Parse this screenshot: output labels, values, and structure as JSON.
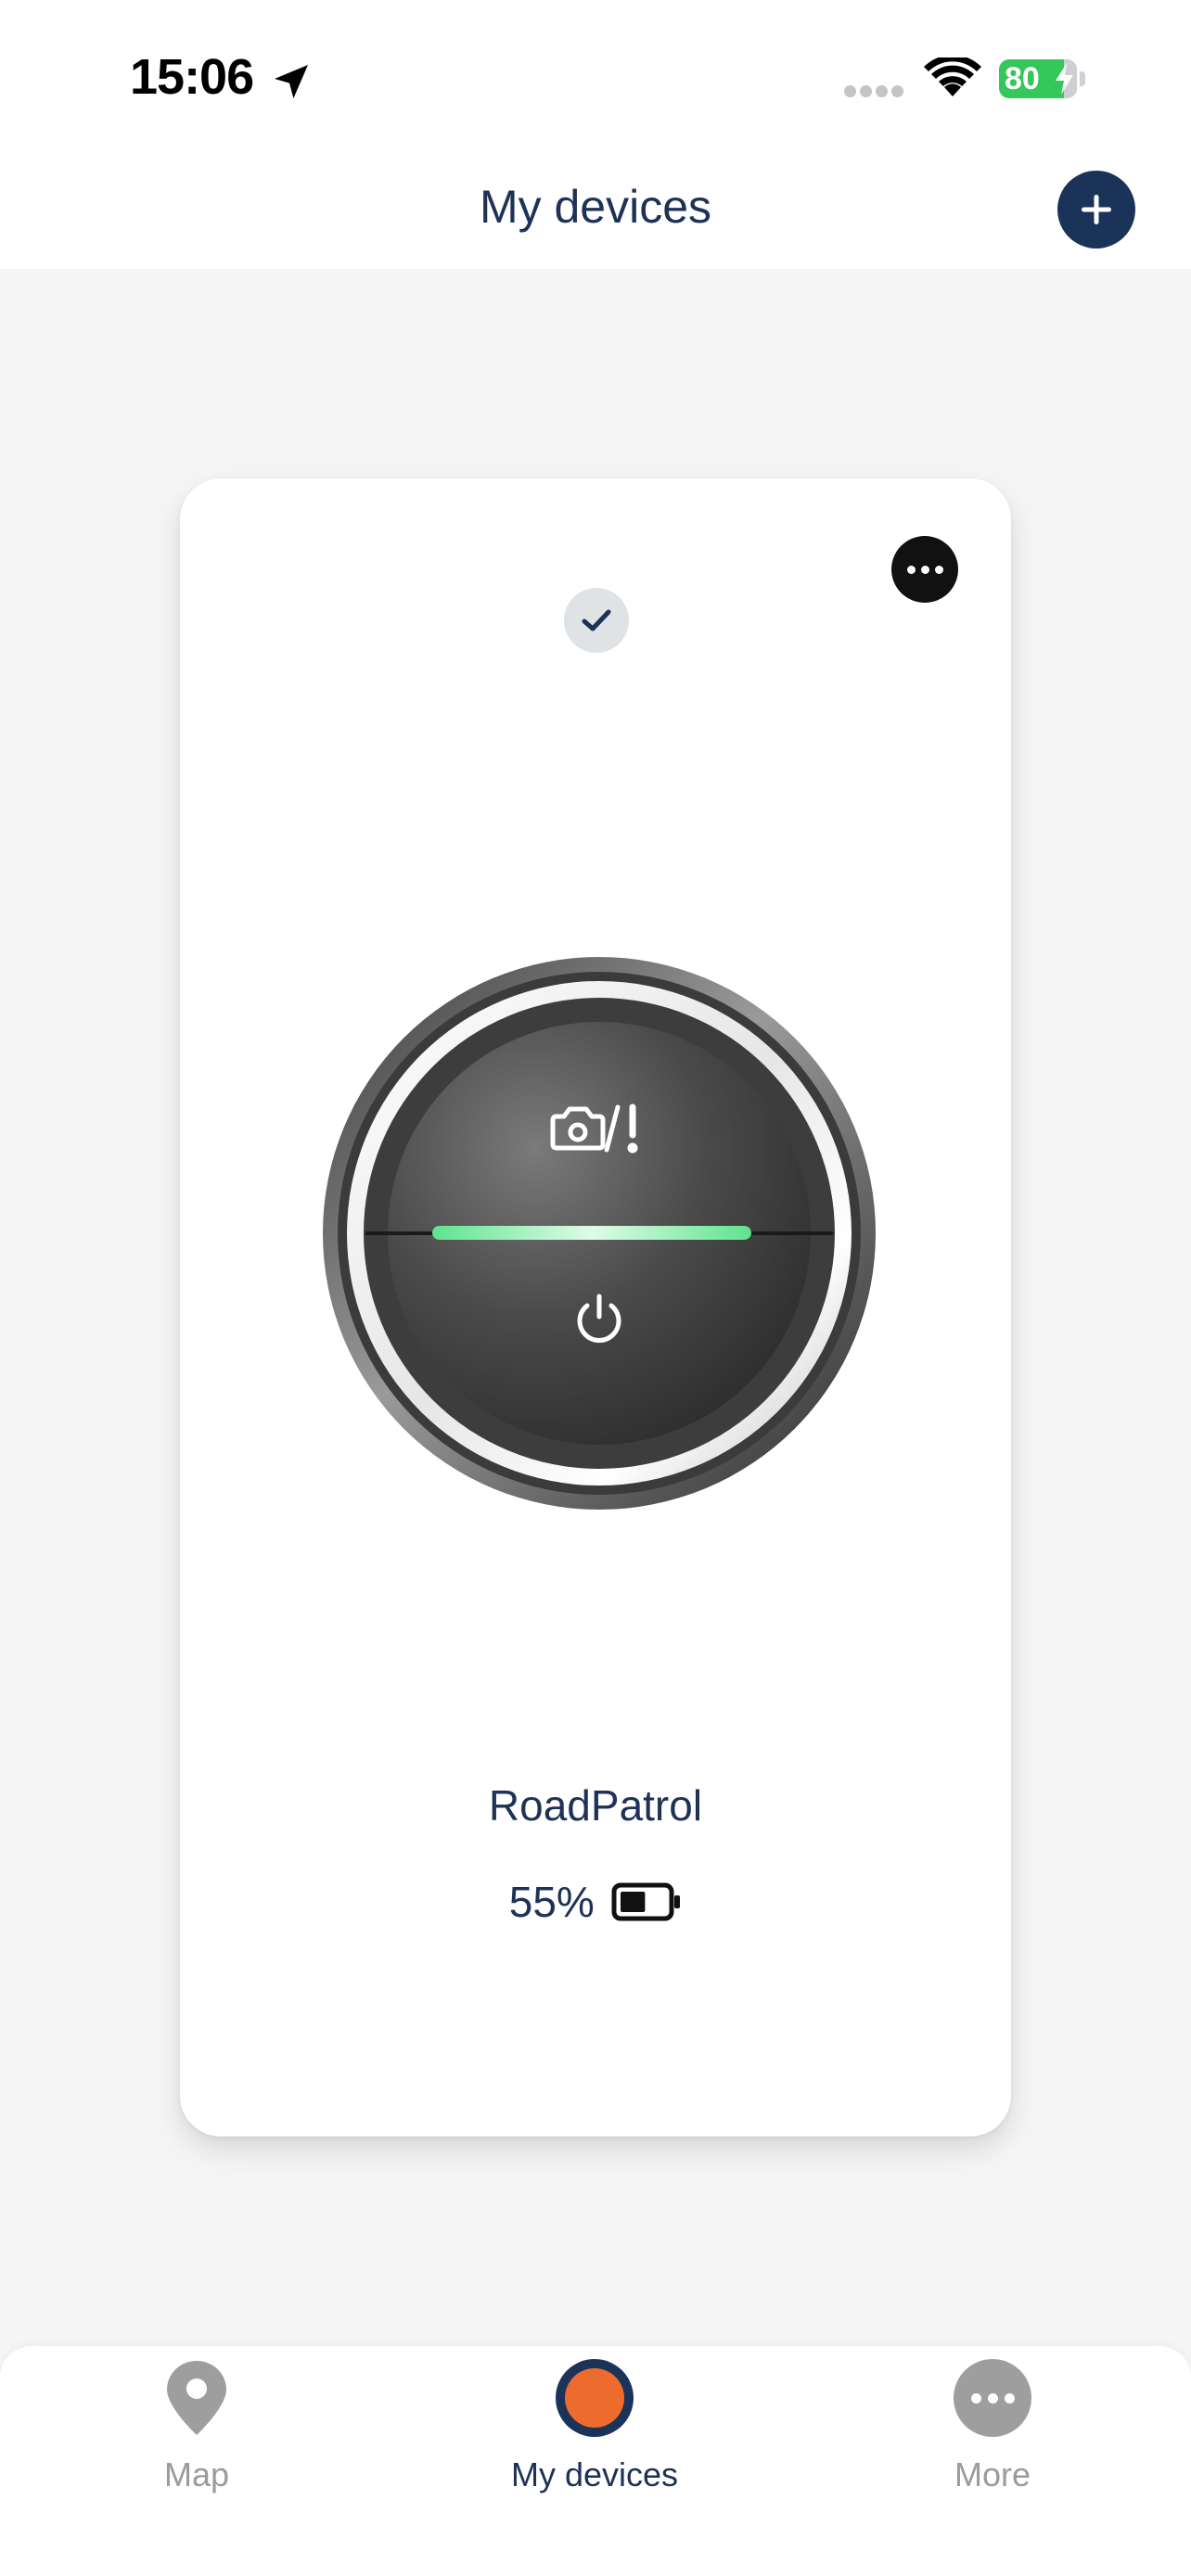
{
  "status_bar": {
    "time": "15:06",
    "battery_percent": "80",
    "icons": [
      "location-arrow-icon",
      "signal-dots-icon",
      "wifi-icon",
      "battery-charging-icon"
    ]
  },
  "header": {
    "title": "My devices",
    "add_icon": "plus-icon"
  },
  "device_card": {
    "name": "RoadPatrol",
    "battery_percent": "55%",
    "battery_level": 0.55,
    "status_icon": "check-icon",
    "menu_icon": "ellipsis-icon",
    "device_button_icons": [
      "camera-alert-icon",
      "power-icon"
    ],
    "led_color": "#5fe38e"
  },
  "bottom_nav": {
    "items": [
      {
        "label": "Map",
        "icon": "map-pin-icon",
        "active": false
      },
      {
        "label": "My devices",
        "icon": "device-dot-icon",
        "active": true
      },
      {
        "label": "More",
        "icon": "more-dots-icon",
        "active": false
      }
    ]
  },
  "colors": {
    "navy": "#1c3359",
    "orange": "#ec6b2d",
    "background": "#f5f5f6",
    "inactive": "#9b9b9b",
    "charging_green": "#34c759"
  }
}
